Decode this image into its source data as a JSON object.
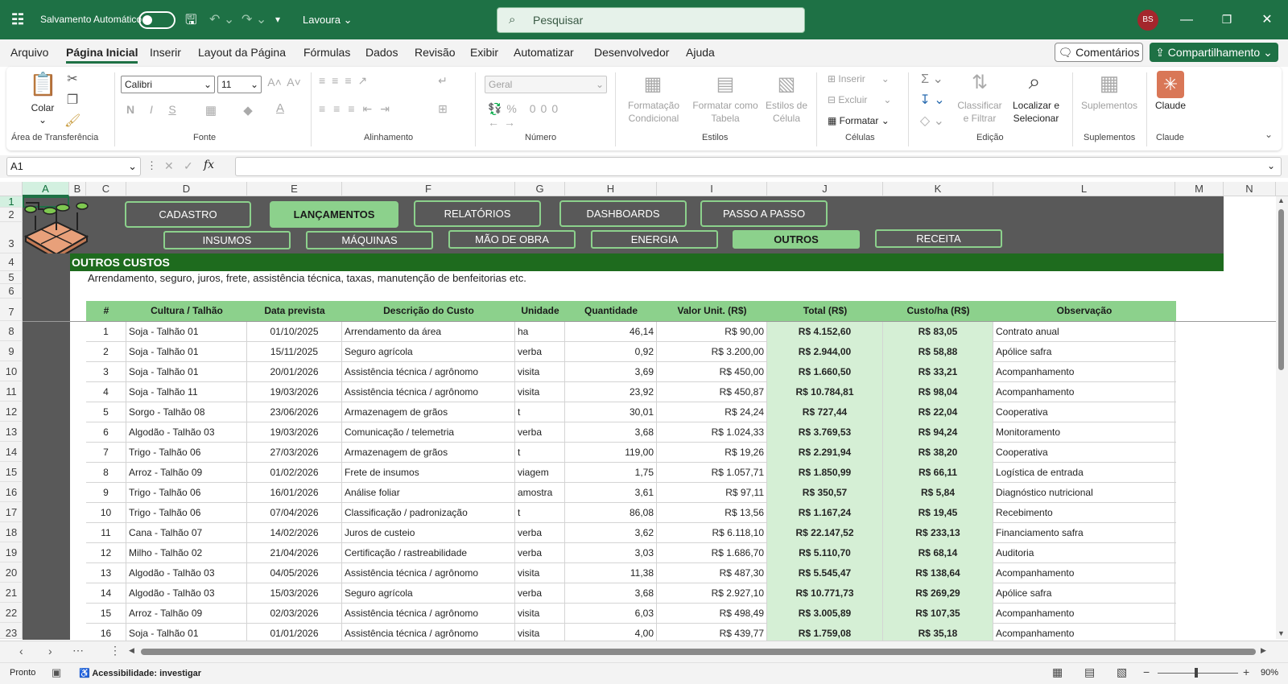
{
  "titlebar": {
    "autosave_label": "Salvamento Automático",
    "workbook_name": "Lavoura",
    "search_placeholder": "Pesquisar",
    "avatar_initials": "BS"
  },
  "menu": [
    "Arquivo",
    "Página Inicial",
    "Inserir",
    "Layout da Página",
    "Fórmulas",
    "Dados",
    "Revisão",
    "Exibir",
    "Automatizar",
    "Desenvolvedor",
    "Ajuda"
  ],
  "menu_actions": {
    "comments": "Comentários",
    "share": "Compartilhamento"
  },
  "ribbon": {
    "paste": "Colar",
    "groups": [
      "Área de Transferência",
      "Fonte",
      "Alinhamento",
      "Número",
      "Estilos",
      "Células",
      "Edição",
      "Suplementos",
      "Claude"
    ],
    "font_name": "Calibri",
    "font_size": "11",
    "number_format": "Geral",
    "cond_format": [
      "Formatação",
      "Condicional"
    ],
    "format_table": [
      "Formatar como",
      "Tabela"
    ],
    "cell_styles": [
      "Estilos de",
      "Célula"
    ],
    "insert": "Inserir",
    "delete": "Excluir",
    "format": "Formatar",
    "sort_filter": [
      "Classificar",
      "e Filtrar"
    ],
    "find_select": [
      "Localizar e",
      "Selecionar"
    ],
    "addins": "Suplementos",
    "claude": "Claude"
  },
  "formula_bar": {
    "name_box": "A1",
    "fx": "fx"
  },
  "columns": [
    "A",
    "B",
    "C",
    "D",
    "E",
    "F",
    "G",
    "H",
    "I",
    "J",
    "K",
    "L",
    "M",
    "N"
  ],
  "rows": [
    "1",
    "2",
    "3",
    "4",
    "5",
    "6",
    "7",
    "8",
    "9",
    "10",
    "11",
    "12",
    "13",
    "14",
    "15",
    "16",
    "17",
    "18",
    "19",
    "20",
    "21",
    "22",
    "23"
  ],
  "nav": {
    "main": [
      "CADASTRO",
      "LANÇAMENTOS",
      "RELATÓRIOS",
      "DASHBOARDS",
      "PASSO A PASSO"
    ],
    "main_active": "LANÇAMENTOS",
    "sub": [
      "INSUMOS",
      "MÁQUINAS",
      "MÃO DE OBRA",
      "ENERGIA",
      "OUTROS",
      "RECEITA"
    ],
    "sub_active": "OUTROS"
  },
  "section": {
    "title": "OUTROS CUSTOS",
    "description": "Arrendamento, seguro, juros, frete, assistência técnica, taxas, manutenção de benfeitorias etc."
  },
  "table": {
    "headers": [
      "#",
      "Cultura / Talhão",
      "Data prevista",
      "Descrição do Custo",
      "Unidade",
      "Quantidade",
      "Valor Unit. (R$)",
      "Total (R$)",
      "Custo/ha (R$)",
      "Observação"
    ],
    "rows": [
      [
        "1",
        "Soja - Talhão 01",
        "01/10/2025",
        "Arrendamento da área",
        "ha",
        "46,14",
        "R$ 90,00",
        "R$ 4.152,60",
        "R$ 83,05",
        "Contrato anual"
      ],
      [
        "2",
        "Soja - Talhão 01",
        "15/11/2025",
        "Seguro agrícola",
        "verba",
        "0,92",
        "R$ 3.200,00",
        "R$ 2.944,00",
        "R$ 58,88",
        "Apólice safra"
      ],
      [
        "3",
        "Soja - Talhão 01",
        "20/01/2026",
        "Assistência técnica / agrônomo",
        "visita",
        "3,69",
        "R$ 450,00",
        "R$ 1.660,50",
        "R$ 33,21",
        "Acompanhamento"
      ],
      [
        "4",
        "Soja - Talhão 11",
        "19/03/2026",
        "Assistência técnica / agrônomo",
        "visita",
        "23,92",
        "R$ 450,87",
        "R$ 10.784,81",
        "R$ 98,04",
        "Acompanhamento"
      ],
      [
        "5",
        "Sorgo - Talhão 08",
        "23/06/2026",
        "Armazenagem de grãos",
        "t",
        "30,01",
        "R$ 24,24",
        "R$ 727,44",
        "R$ 22,04",
        "Cooperativa"
      ],
      [
        "6",
        "Algodão - Talhão 03",
        "19/03/2026",
        "Comunicação / telemetria",
        "verba",
        "3,68",
        "R$ 1.024,33",
        "R$ 3.769,53",
        "R$ 94,24",
        "Monitoramento"
      ],
      [
        "7",
        "Trigo - Talhão 06",
        "27/03/2026",
        "Armazenagem de grãos",
        "t",
        "119,00",
        "R$ 19,26",
        "R$ 2.291,94",
        "R$ 38,20",
        "Cooperativa"
      ],
      [
        "8",
        "Arroz - Talhão 09",
        "01/02/2026",
        "Frete de insumos",
        "viagem",
        "1,75",
        "R$ 1.057,71",
        "R$ 1.850,99",
        "R$ 66,11",
        "Logística de entrada"
      ],
      [
        "9",
        "Trigo - Talhão 06",
        "16/01/2026",
        "Análise foliar",
        "amostra",
        "3,61",
        "R$ 97,11",
        "R$ 350,57",
        "R$ 5,84",
        "Diagnóstico nutricional"
      ],
      [
        "10",
        "Trigo - Talhão 06",
        "07/04/2026",
        "Classificação / padronização",
        "t",
        "86,08",
        "R$ 13,56",
        "R$ 1.167,24",
        "R$ 19,45",
        "Recebimento"
      ],
      [
        "11",
        "Cana - Talhão 07",
        "14/02/2026",
        "Juros de custeio",
        "verba",
        "3,62",
        "R$ 6.118,10",
        "R$ 22.147,52",
        "R$ 233,13",
        "Financiamento safra"
      ],
      [
        "12",
        "Milho - Talhão 02",
        "21/04/2026",
        "Certificação / rastreabilidade",
        "verba",
        "3,03",
        "R$ 1.686,70",
        "R$ 5.110,70",
        "R$ 68,14",
        "Auditoria"
      ],
      [
        "13",
        "Algodão - Talhão 03",
        "04/05/2026",
        "Assistência técnica / agrônomo",
        "visita",
        "11,38",
        "R$ 487,30",
        "R$ 5.545,47",
        "R$ 138,64",
        "Acompanhamento"
      ],
      [
        "14",
        "Algodão - Talhão 03",
        "15/03/2026",
        "Seguro agrícola",
        "verba",
        "3,68",
        "R$ 2.927,10",
        "R$ 10.771,73",
        "R$ 269,29",
        "Apólice safra"
      ],
      [
        "15",
        "Arroz - Talhão 09",
        "02/03/2026",
        "Assistência técnica / agrônomo",
        "visita",
        "6,03",
        "R$ 498,49",
        "R$ 3.005,89",
        "R$ 107,35",
        "Acompanhamento"
      ],
      [
        "16",
        "Soja - Talhão 01",
        "01/01/2026",
        "Assistência técnica / agrônomo",
        "visita",
        "4,00",
        "R$ 439,77",
        "R$ 1.759,08",
        "R$ 35,18",
        "Acompanhamento"
      ]
    ]
  },
  "status": {
    "ready": "Pronto",
    "accessibility": "Acessibilidade: investigar",
    "zoom": "90%"
  },
  "colors": {
    "excel_green": "#1e7145",
    "nav_green": "#8cd18c",
    "banner_gray": "#595959",
    "title_green": "#1e6b1e",
    "cell_highlight": "#d5efd5"
  }
}
